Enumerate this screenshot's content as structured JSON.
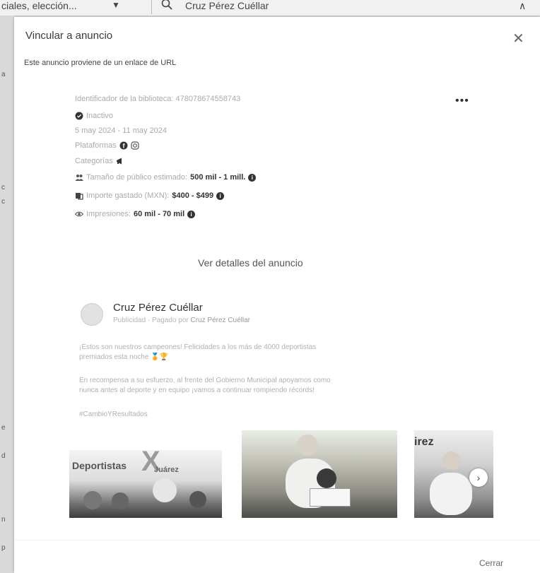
{
  "background": {
    "filter_label": "ciales, elección...",
    "search_query": "Cruz Pérez Cuéllar"
  },
  "modal": {
    "title": "Vincular a anuncio",
    "subtitle": "Este anuncio proviene de un enlace de URL",
    "footer_close": "Cerrar"
  },
  "ad": {
    "library_id": "Identificador de la biblioteca: 478078674558743",
    "status": "Inactivo",
    "dates": "5 may 2024 - 11 may 2024",
    "platforms_label": "Plataformas",
    "categories_label": "Categorías",
    "audience_label": "Tamaño de público estimado:",
    "audience_value": "500 mil - 1 mill.",
    "spend_label": "Importe gastado (MXN):",
    "spend_value": "$400 - $499",
    "impressions_label": "Impresiones:",
    "impressions_value": "60 mil - 70 mil",
    "details_link": "Ver detalles del anuncio"
  },
  "post": {
    "advertiser": "Cruz Pérez Cuéllar",
    "sponsor_prefix": "Publicidad · Pagado por",
    "sponsor_name": "Cruz Pérez Cuéllar",
    "line1": "¡Estos son nuestros campeones! Felicidades a los más de 4000 deportistas",
    "line2": "premiados esta noche 🏅🏆",
    "line3": "En recompensa a su esfuerzo, al frente del Gobierno Municipal apoyamos como",
    "line4": "nunca antes al deporte y en equipo ¡vamos a continuar rompiendo récords!",
    "hashtag": "#CambioYResultados",
    "slide1_text1": "Deportistas",
    "slide1_text2": "Juárez",
    "slide3_text": "irez"
  },
  "icons": {
    "close": "✕",
    "more": "•••",
    "next": "›"
  }
}
